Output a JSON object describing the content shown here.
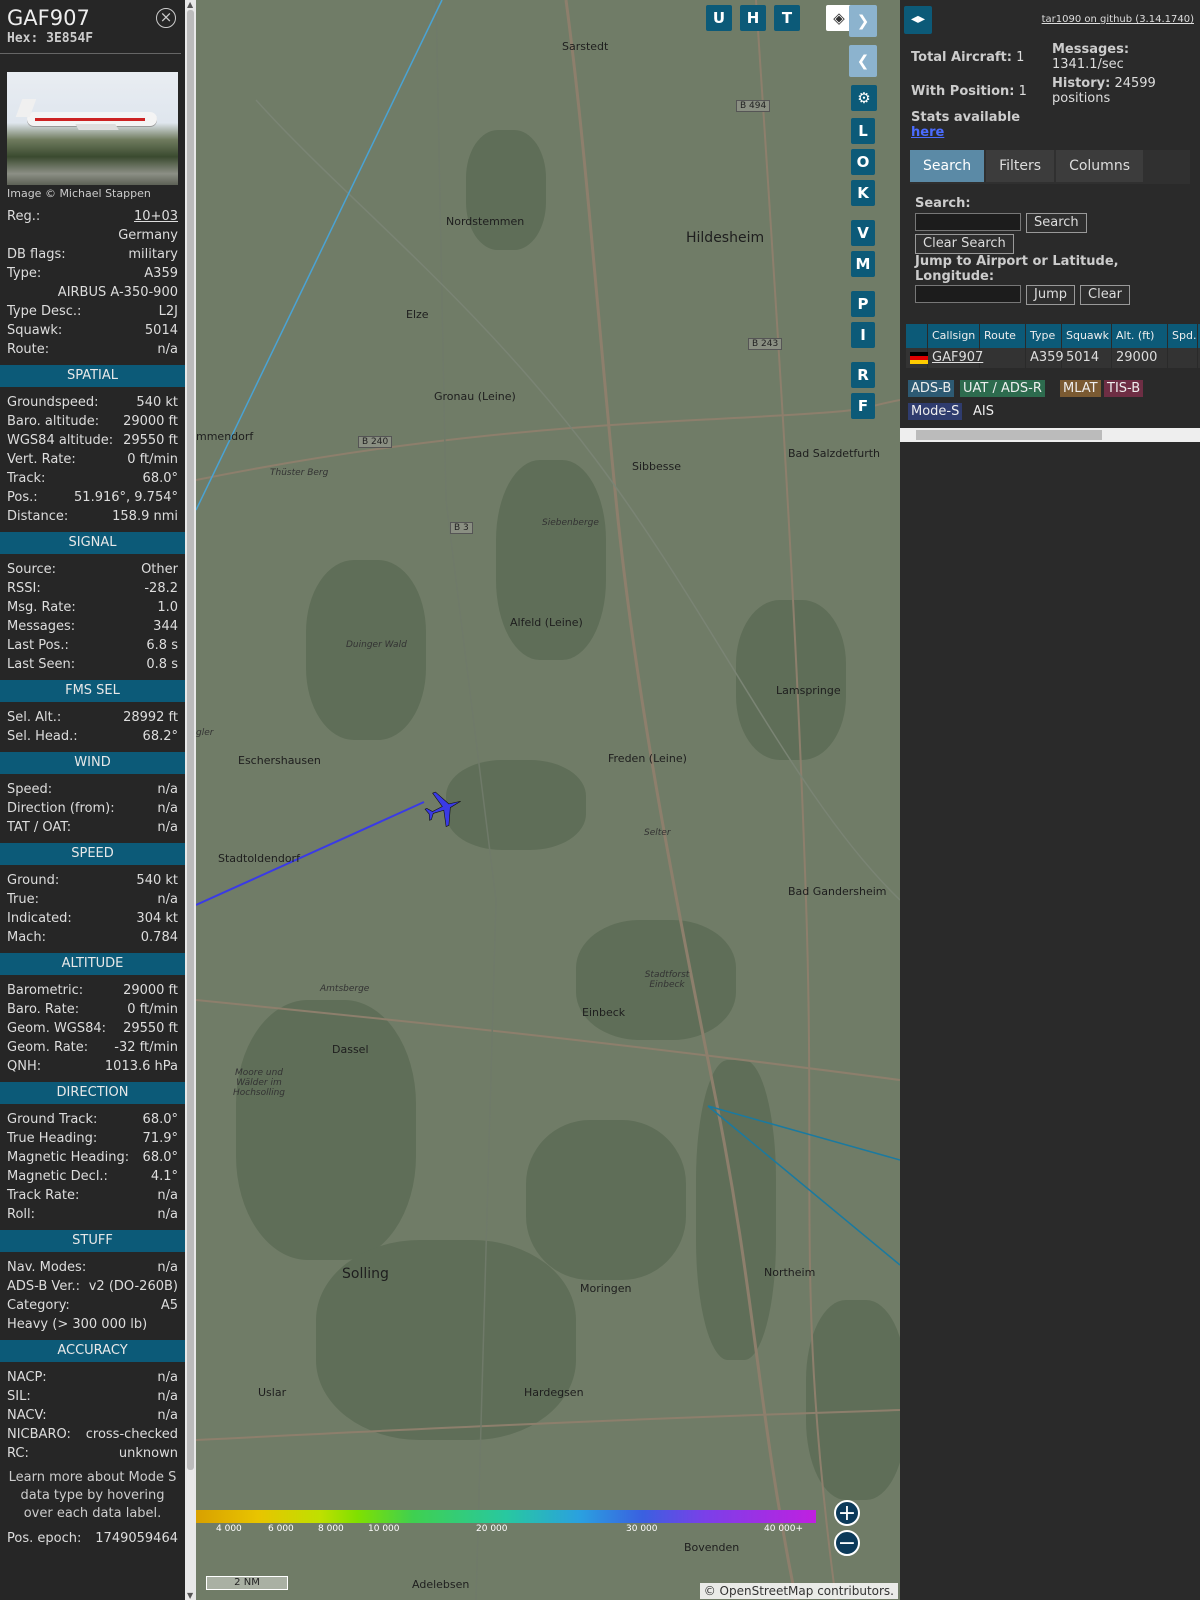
{
  "info": {
    "callsign": "GAF907",
    "hex_label": "Hex:",
    "hex": "3E854F",
    "close_glyph": "×",
    "photo_credit": "Image © Michael Stappen",
    "top_rows": [
      {
        "k": "Reg.:",
        "v": "10+03",
        "link": true
      },
      {
        "k": "",
        "v": "Germany"
      },
      {
        "k": "DB flags:",
        "v": "military"
      },
      {
        "k": "Type:",
        "v": "A359"
      },
      {
        "k": "",
        "v": "AIRBUS A-350-900"
      },
      {
        "k": "Type Desc.:",
        "v": "L2J"
      },
      {
        "k": "Squawk:",
        "v": "5014"
      },
      {
        "k": "Route:",
        "v": "n/a"
      }
    ],
    "sections": [
      {
        "title": "SPATIAL",
        "rows": [
          {
            "k": "Groundspeed:",
            "v": "540 kt"
          },
          {
            "k": "Baro. altitude:",
            "v": "29000 ft"
          },
          {
            "k": "WGS84 altitude:",
            "v": "29550 ft"
          },
          {
            "k": "Vert. Rate:",
            "v": "0 ft/min"
          },
          {
            "k": "Track:",
            "v": "68.0°"
          },
          {
            "k": "Pos.:",
            "v": "51.916°, 9.754°"
          },
          {
            "k": "Distance:",
            "v": "158.9 nmi"
          }
        ]
      },
      {
        "title": "SIGNAL",
        "rows": [
          {
            "k": "Source:",
            "v": "Other"
          },
          {
            "k": "RSSI:",
            "v": "-28.2"
          },
          {
            "k": "Msg. Rate:",
            "v": "1.0"
          },
          {
            "k": "Messages:",
            "v": "344"
          },
          {
            "k": "Last Pos.:",
            "v": "6.8 s"
          },
          {
            "k": "Last Seen:",
            "v": "0.8 s"
          }
        ]
      },
      {
        "title": "FMS SEL",
        "rows": [
          {
            "k": "Sel. Alt.:",
            "v": "28992 ft"
          },
          {
            "k": "Sel. Head.:",
            "v": "68.2°"
          }
        ]
      },
      {
        "title": "WIND",
        "rows": [
          {
            "k": "Speed:",
            "v": "n/a"
          },
          {
            "k": "Direction (from):",
            "v": "n/a"
          },
          {
            "k": "TAT / OAT:",
            "v": "n/a"
          }
        ]
      },
      {
        "title": "SPEED",
        "rows": [
          {
            "k": "Ground:",
            "v": "540 kt"
          },
          {
            "k": "True:",
            "v": "n/a"
          },
          {
            "k": "Indicated:",
            "v": "304 kt"
          },
          {
            "k": "Mach:",
            "v": "0.784"
          }
        ]
      },
      {
        "title": "ALTITUDE",
        "rows": [
          {
            "k": "Barometric:",
            "v": "29000 ft"
          },
          {
            "k": "Baro. Rate:",
            "v": "0 ft/min"
          },
          {
            "k": "Geom. WGS84:",
            "v": "29550 ft"
          },
          {
            "k": "Geom. Rate:",
            "v": "-32 ft/min"
          },
          {
            "k": "QNH:",
            "v": "1013.6 hPa"
          }
        ]
      },
      {
        "title": "DIRECTION",
        "rows": [
          {
            "k": "Ground Track:",
            "v": "68.0°"
          },
          {
            "k": "True Heading:",
            "v": "71.9°"
          },
          {
            "k": "Magnetic Heading:",
            "v": "68.0°"
          },
          {
            "k": "Magnetic Decl.:",
            "v": "4.1°"
          },
          {
            "k": "Track Rate:",
            "v": "n/a"
          },
          {
            "k": "Roll:",
            "v": "n/a"
          }
        ]
      },
      {
        "title": "STUFF",
        "rows": [
          {
            "k": "Nav. Modes:",
            "v": "n/a"
          },
          {
            "k": "ADS-B Ver.:",
            "v": "v2 (DO-260B)"
          },
          {
            "k": "Category:",
            "v": "A5"
          },
          {
            "k": "Heavy (> 300 000 lb)",
            "v": ""
          }
        ]
      },
      {
        "title": "ACCURACY",
        "rows": [
          {
            "k": "NACP:",
            "v": "n/a"
          },
          {
            "k": "SIL:",
            "v": "n/a"
          },
          {
            "k": "NACV:",
            "v": "n/a"
          },
          {
            "k": "NICBARO:",
            "v": "cross-checked"
          },
          {
            "k": "RC:",
            "v": "unknown"
          }
        ]
      }
    ],
    "note": "Learn more about Mode S data type by hovering over each data label.",
    "epoch_label": "Pos. epoch:",
    "epoch": "1749059464"
  },
  "map": {
    "places": [
      {
        "name": "Sarstedt"
      },
      {
        "name": "Nordstemmen"
      },
      {
        "name": "Hildesheim"
      },
      {
        "name": "Elze"
      },
      {
        "name": "Gronau (Leine)"
      },
      {
        "name": "Sibbesse"
      },
      {
        "name": "Bad Salzdetfurth"
      },
      {
        "name": "Siebenberge"
      },
      {
        "name": "Alfeld (Leine)"
      },
      {
        "name": "Lamspringe"
      },
      {
        "name": "Eschershausen"
      },
      {
        "name": "Freden (Leine)"
      },
      {
        "name": "Stadtoldendorf"
      },
      {
        "name": "Bad Gandersheim"
      },
      {
        "name": "Einbeck"
      },
      {
        "name": "Dassel"
      },
      {
        "name": "Solling"
      },
      {
        "name": "Northeim"
      },
      {
        "name": "Moringen"
      },
      {
        "name": "Uslar"
      },
      {
        "name": "Hardegsen"
      },
      {
        "name": "Bovenden"
      },
      {
        "name": "Adelebsen"
      },
      {
        "name": "mmendorf"
      },
      {
        "name": "Thüster Berg"
      },
      {
        "name": "Duinger Wald"
      },
      {
        "name": "Amtsberge"
      },
      {
        "name": "Stadtforst Einbeck"
      },
      {
        "name": "Moore und Wälder im Hochsolling"
      },
      {
        "name": "Selter"
      },
      {
        "name": "gler"
      }
    ],
    "roads": [
      "B 494",
      "B 243",
      "B 240",
      "B 3"
    ],
    "layer_buttons": [
      "U",
      "H",
      "T"
    ],
    "side_buttons": [
      "L",
      "O",
      "K",
      "V",
      "M",
      "P",
      "I",
      "R",
      "F"
    ],
    "alt_scale": [
      "4 000",
      "6 000",
      "8 000",
      "10 000",
      "20 000",
      "30 000",
      "40 000+"
    ],
    "scale_label": "2 NM",
    "attribution_prefix": "© ",
    "attribution_link": "OpenStreetMap",
    "attribution_suffix": " contributors.",
    "zoom_in": "+",
    "zoom_out": "−"
  },
  "side": {
    "github": "tar1090 on github (3.14.1740)",
    "total_aircraft_label": "Total Aircraft:",
    "total_aircraft": "1",
    "with_position_label": "With Position:",
    "with_position": "1",
    "messages_label": "Messages:",
    "messages": "1341.1/sec",
    "history_label": "History:",
    "history": "24599 positions",
    "stats_label": "Stats available",
    "stats_link": "here",
    "tabs": [
      "Search",
      "Filters",
      "Columns"
    ],
    "search_label": "Search:",
    "search_button": "Search",
    "clear_search_button": "Clear Search",
    "jump_label": "Jump to Airport or Latitude, Longitude:",
    "jump_button": "Jump",
    "clear_button": "Clear",
    "columns": [
      "Callsign",
      "Route",
      "Type",
      "Squawk",
      "Alt. (ft)",
      "Spd."
    ],
    "rows": [
      {
        "callsign": "GAF907",
        "route": "",
        "type": "A359",
        "squawk": "5014",
        "alt": "29000",
        "spd": ""
      }
    ],
    "legend": [
      {
        "label": "ADS-B",
        "color": "#2d5a73"
      },
      {
        "label": "UAT / ADS-R",
        "color": "#2d6b4e"
      },
      {
        "label": "MLAT",
        "color": "#7a5a32"
      },
      {
        "label": "TIS-B",
        "color": "#6e2e44"
      },
      {
        "label": "Mode-S",
        "color": "#2f3c6e"
      },
      {
        "label": "AIS",
        "color": "#2a2a2a"
      }
    ]
  }
}
